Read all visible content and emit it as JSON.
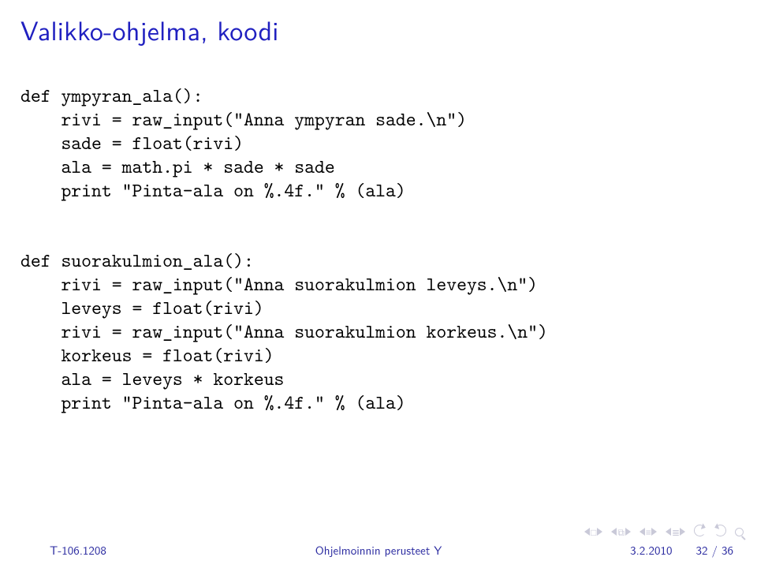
{
  "title": "Valikko-ohjelma, koodi",
  "code1": "def ympyran_ala():\n    rivi = raw_input(\"Anna ympyran sade.\\n\")\n    sade = float(rivi)\n    ala = math.pi * sade * sade\n    print \"Pinta-ala on %.4f.\" % (ala)",
  "code2": "def suorakulmion_ala():\n    rivi = raw_input(\"Anna suorakulmion leveys.\\n\")\n    leveys = float(rivi)\n    rivi = raw_input(\"Anna suorakulmion korkeus.\\n\")\n    korkeus = float(rivi)\n    ala = leveys * korkeus\n    print \"Pinta-ala on %.4f.\" % (ala)",
  "footer": {
    "course": "T-106.1208",
    "center": "Ohjelmoinnin perusteet Y",
    "date": "3.2.2010",
    "page_current": "32",
    "page_total": "36",
    "sep": " / "
  }
}
